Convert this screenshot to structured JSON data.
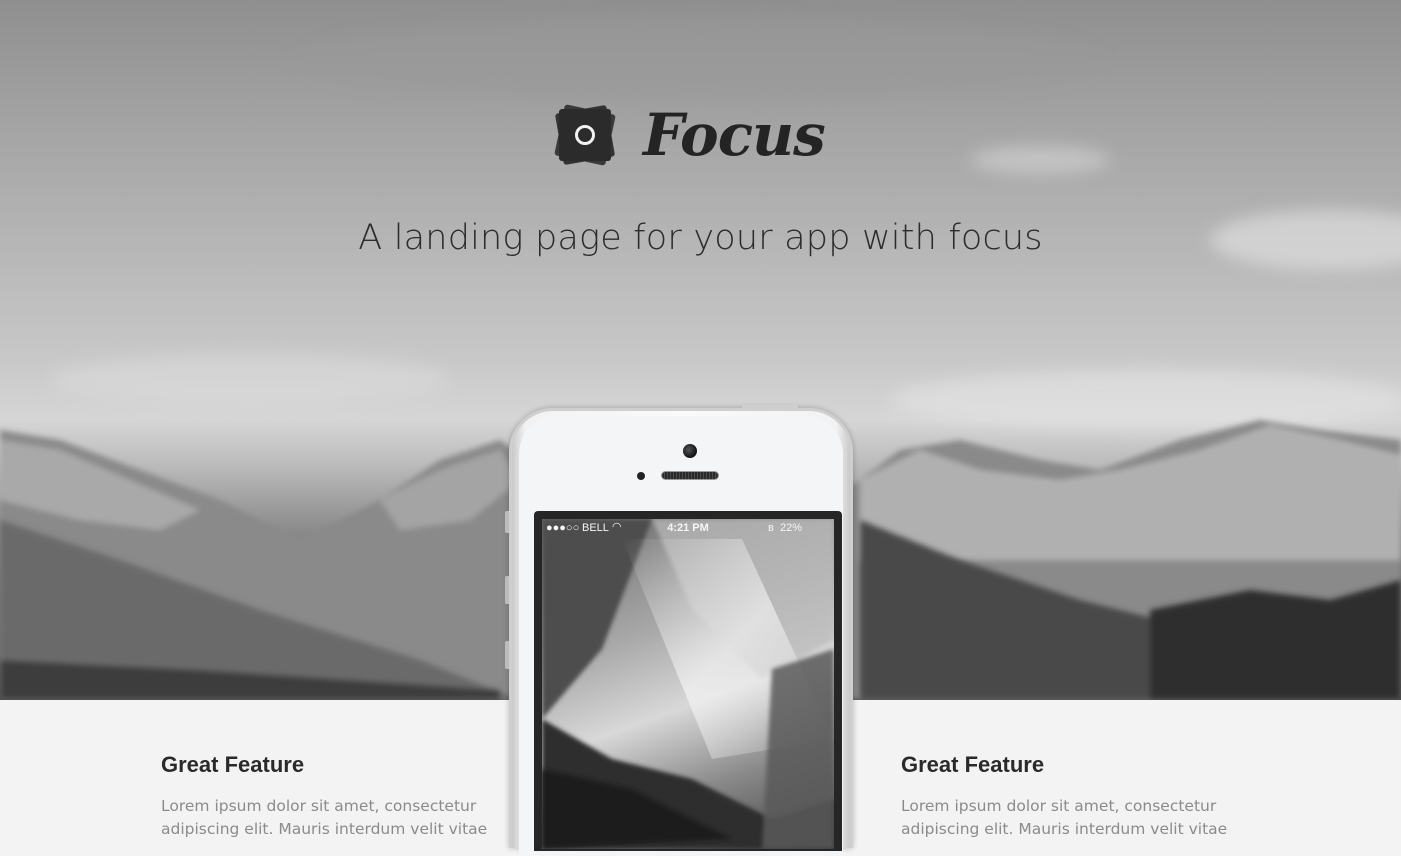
{
  "hero": {
    "brand_name": "Focus",
    "tagline": "A landing page for your app with focus"
  },
  "phone": {
    "status_bar": {
      "signal": "●●●○○",
      "carrier": "BELL",
      "wifi_icon": "wifi-icon",
      "time": "4:21 PM",
      "bluetooth_icon": "bluetooth-icon",
      "battery": "22%"
    }
  },
  "features": [
    {
      "title": "Great Feature",
      "text": "Lorem ipsum dolor sit amet, consectetur adipiscing elit. Mauris interdum velit vitae"
    },
    {
      "title": "Great Feature",
      "text": "Lorem ipsum dolor sit amet, consectetur adipiscing elit. Mauris interdum velit vitae"
    }
  ],
  "colors": {
    "feature_bg": "#f3f3f3",
    "heading": "#2a2a2a",
    "body_text": "#8b8b8b"
  }
}
